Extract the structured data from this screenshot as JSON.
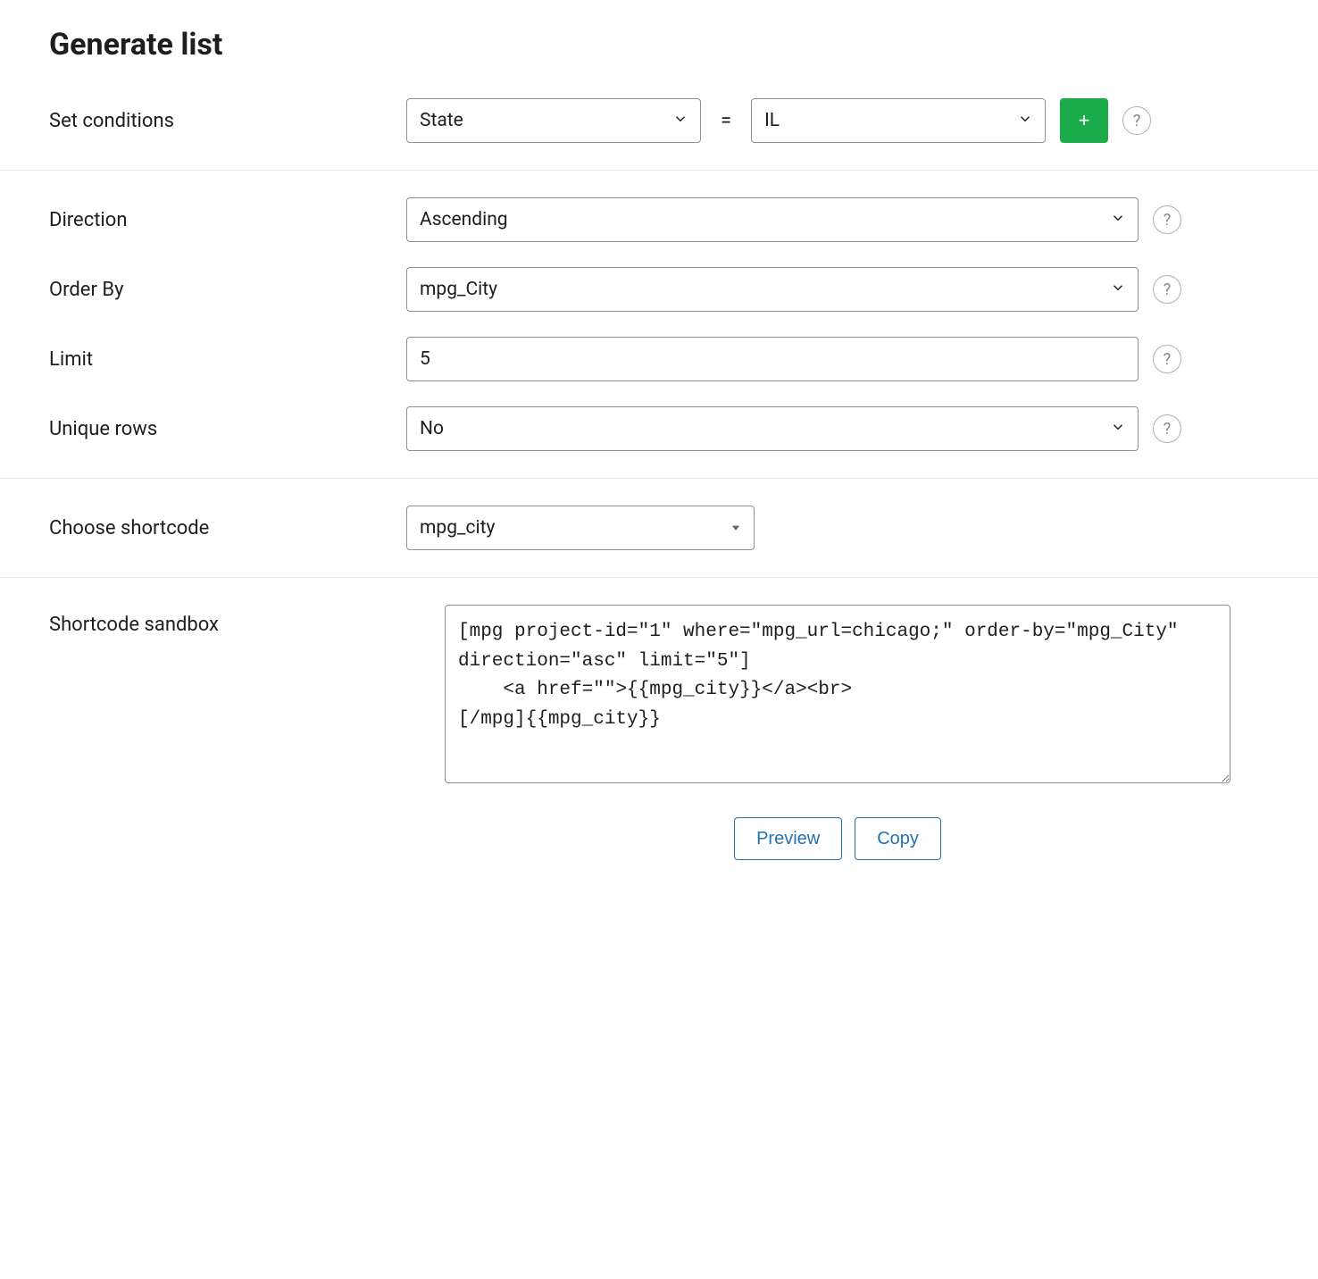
{
  "title": "Generate list",
  "conditions": {
    "label": "Set conditions",
    "field_value": "State",
    "operator": "=",
    "match_value": "IL",
    "add_label": "+"
  },
  "direction": {
    "label": "Direction",
    "value": "Ascending"
  },
  "order_by": {
    "label": "Order By",
    "value": "mpg_City"
  },
  "limit": {
    "label": "Limit",
    "value": "5"
  },
  "unique_rows": {
    "label": "Unique rows",
    "value": "No"
  },
  "shortcode": {
    "label": "Choose shortcode",
    "value": "mpg_city"
  },
  "sandbox": {
    "label": "Shortcode sandbox",
    "value": "[mpg project-id=\"1\" where=\"mpg_url=chicago;\" order-by=\"mpg_City\" direction=\"asc\" limit=\"5\"]\n    <a href=\"\">{{mpg_city}}</a><br>\n[/mpg]{{mpg_city}}",
    "preview_label": "Preview",
    "copy_label": "Copy"
  },
  "help_glyph": "?"
}
